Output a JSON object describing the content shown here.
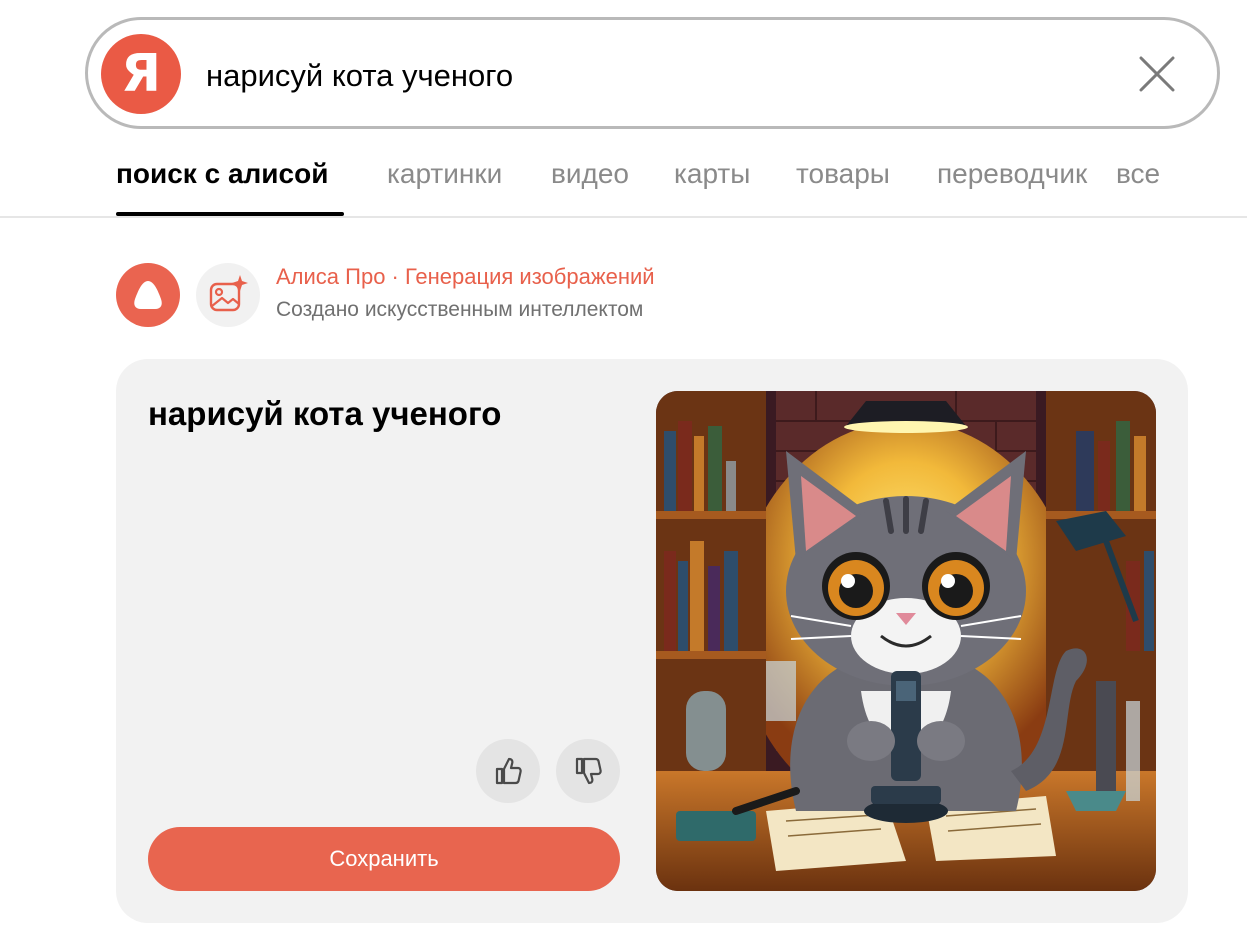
{
  "search": {
    "logo_letter": "Я",
    "query": "нарисуй кота ученого"
  },
  "tabs": [
    {
      "label": "поиск с  алисой",
      "active": true
    },
    {
      "label": "картинки",
      "active": false
    },
    {
      "label": "видео",
      "active": false
    },
    {
      "label": "карты",
      "active": false
    },
    {
      "label": "товары",
      "active": false
    },
    {
      "label": "переводчик",
      "active": false
    },
    {
      "label": "все",
      "active": false
    }
  ],
  "source": {
    "title": "Алиса Про · Генерация изображений",
    "subtitle": "Создано искусственным интеллектом"
  },
  "card": {
    "title": "нарисуй кота ученого",
    "save_label": "Сохранить",
    "image_name": "scientist-cat-illustration"
  },
  "colors": {
    "brand_red": "#ea5a45",
    "accent_text": "#e8604b",
    "save_button": "#e8654f",
    "card_bg": "#f2f2f2",
    "tab_inactive": "#8a8a8a"
  },
  "icons": [
    "yandex-logo-icon",
    "close-icon",
    "alice-icon",
    "image-generation-icon",
    "thumbs-up-icon",
    "thumbs-down-icon"
  ]
}
